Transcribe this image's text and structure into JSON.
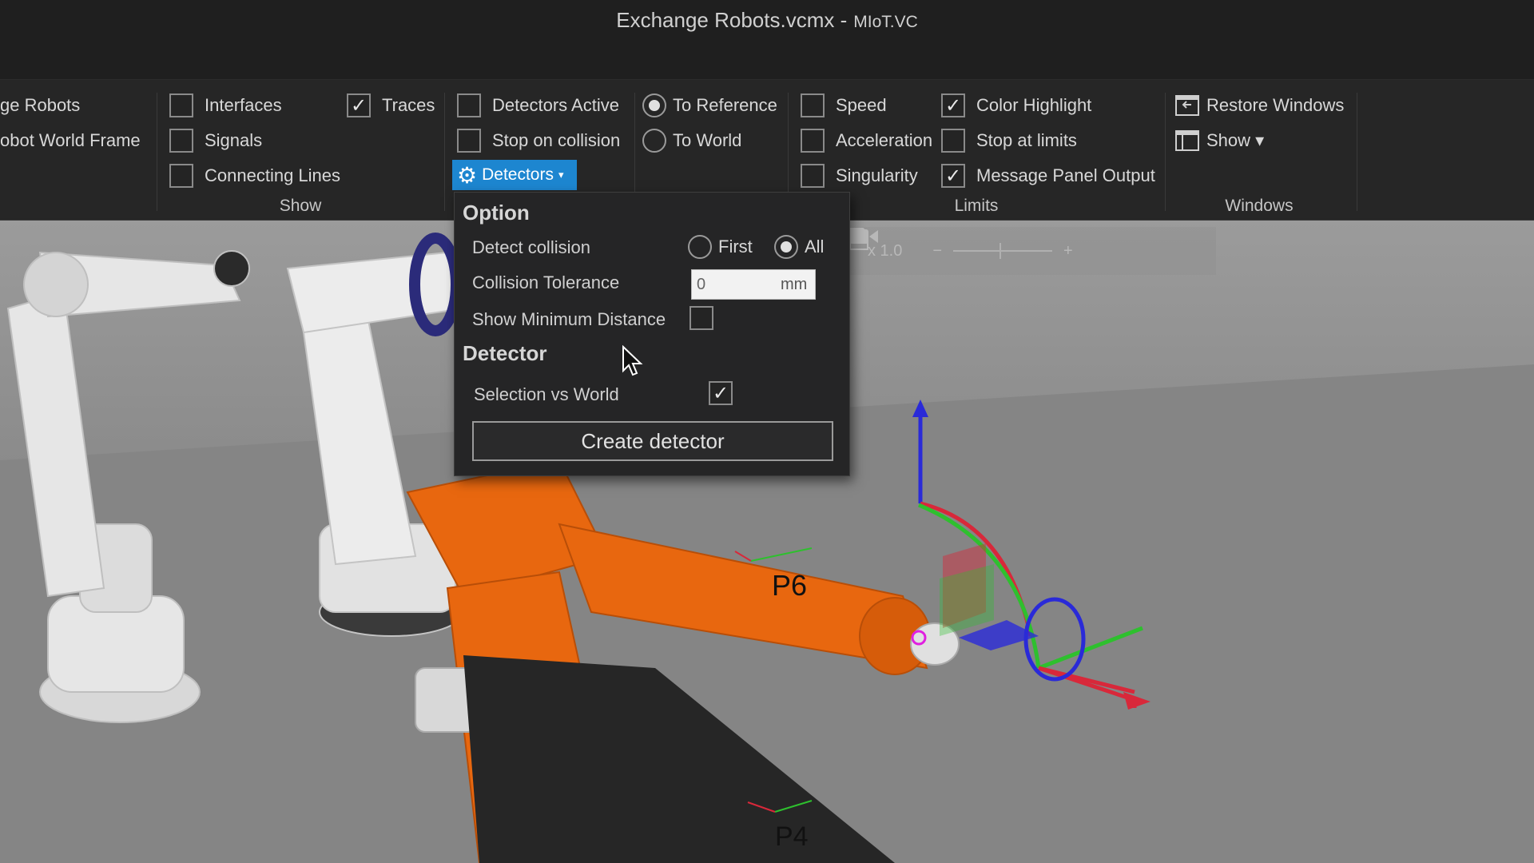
{
  "window": {
    "title": "Exchange Robots.vcmx -",
    "app_name": "MIoT.VC"
  },
  "ribbon": {
    "cut_items": [
      "ge Robots",
      "obot World Frame"
    ],
    "show_group": {
      "label": "Show",
      "items": [
        {
          "label": "Interfaces",
          "checked": false
        },
        {
          "label": "Signals",
          "checked": false
        },
        {
          "label": "Connecting Lines",
          "checked": false
        },
        {
          "label": "Traces",
          "checked": true
        }
      ]
    },
    "detectors_group": {
      "items": [
        {
          "label": "Detectors Active",
          "checked": false
        },
        {
          "label": "Stop on collision",
          "checked": false
        }
      ],
      "dropdown_label": "Detectors",
      "dropdown_arrow": "▾"
    },
    "reference_group": {
      "items": [
        {
          "label": "To Reference",
          "selected": true
        },
        {
          "label": "To World",
          "selected": false
        }
      ]
    },
    "limits_group": {
      "label": "Limits",
      "items": [
        {
          "label": "Speed",
          "checked": false
        },
        {
          "label": "Acceleration",
          "checked": false
        },
        {
          "label": "Singularity",
          "checked": false
        },
        {
          "label": "Color Highlight",
          "checked": true
        },
        {
          "label": "Stop at limits",
          "checked": false
        },
        {
          "label": "Message Panel Output",
          "checked": true
        }
      ]
    },
    "windows_group": {
      "label": "Windows",
      "restore_label": "Restore Windows",
      "show_label": "Show ▾"
    }
  },
  "popup": {
    "option_heading": "Option",
    "detect_collision_label": "Detect collision",
    "first_label": "First",
    "all_label": "All",
    "detect_mode": "All",
    "tolerance_label": "Collision Tolerance",
    "tolerance_value": "0",
    "tolerance_unit": "mm",
    "show_min_distance_label": "Show Minimum Distance",
    "show_min_distance": false,
    "detector_heading": "Detector",
    "selection_vs_world_label": "Selection vs World",
    "selection_vs_world": true,
    "create_button": "Create detector"
  },
  "viewport": {
    "zoom_label": "x 1.0",
    "zoom_minus": "−",
    "zoom_plus": "+",
    "labels": [
      "P6",
      "P4"
    ]
  },
  "colors": {
    "accent": "#1d86d0",
    "robot_orange": "#e8670f",
    "axis_z": "#2a2ad8",
    "axis_x": "#d8283a",
    "axis_y": "#2ec02e"
  },
  "icons": [
    "gear-icon",
    "restore-windows-icon",
    "show-windows-icon",
    "pdf-icon",
    "camera-icon",
    "mouse-cursor-icon"
  ]
}
